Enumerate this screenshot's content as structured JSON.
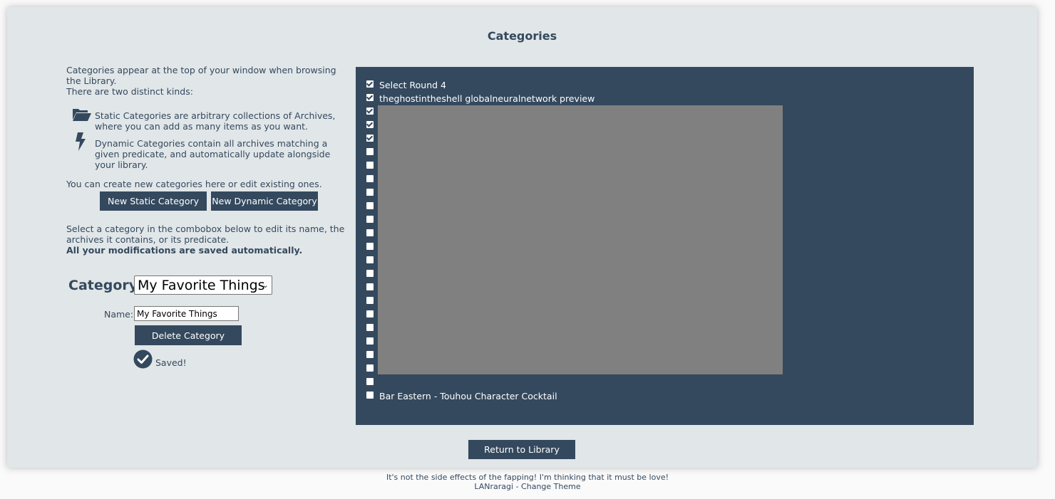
{
  "page": {
    "title": "Categories"
  },
  "intro": {
    "line1": "Categories appear at the top of your window when browsing the Library.",
    "line2": "There are two distinct kinds:",
    "static_desc": "Static Categories are arbitrary collections of Archives, where you can add as many items as you want.",
    "dynamic_desc": "Dynamic Categories contain all archives matching a given predicate, and automatically update alongside your library.",
    "create_note": "You can create new categories here or edit existing ones."
  },
  "buttons": {
    "new_static": "New Static Category",
    "new_dynamic": "New Dynamic Category",
    "delete": "Delete Category",
    "return": "Return to Library"
  },
  "edit_note": {
    "line1": "Select a category in the combobox below to edit its name, the archives it contains, or its predicate.",
    "line2": "All your modifications are saved automatically."
  },
  "form": {
    "category_label": "Category:",
    "category_selected": "My Favorite Things",
    "name_label": "Name:",
    "name_value": "My Favorite Things",
    "saved_text": "Saved!"
  },
  "archives": [
    {
      "label": "Select Round 4",
      "checked": true
    },
    {
      "label": "theghostintheshell globalneuralnetwork preview",
      "checked": true
    },
    {
      "label": "",
      "checked": true
    },
    {
      "label": "",
      "checked": true
    },
    {
      "label": "",
      "checked": true
    },
    {
      "label": "",
      "checked": false
    },
    {
      "label": "",
      "checked": false
    },
    {
      "label": "",
      "checked": false
    },
    {
      "label": "",
      "checked": false
    },
    {
      "label": "",
      "checked": false
    },
    {
      "label": "",
      "checked": false
    },
    {
      "label": "",
      "checked": false
    },
    {
      "label": "",
      "checked": false
    },
    {
      "label": "",
      "checked": false
    },
    {
      "label": "",
      "checked": false
    },
    {
      "label": "",
      "checked": false
    },
    {
      "label": "",
      "checked": false
    },
    {
      "label": "",
      "checked": false
    },
    {
      "label": "",
      "checked": false
    },
    {
      "label": "",
      "checked": false
    },
    {
      "label": "",
      "checked": false
    },
    {
      "label": "",
      "checked": false
    },
    {
      "label": "",
      "checked": false
    },
    {
      "label": "Bar Eastern - Touhou Character Cocktail",
      "checked": false
    }
  ],
  "footer": {
    "quote": "It's not the side effects of the fapping! I'm thinking that it must be love!",
    "app": "LANraragi",
    "separator": " - ",
    "theme_link": "Change Theme"
  },
  "icons": {
    "static": "folder-open-icon",
    "dynamic": "bolt-icon",
    "saved": "check-circle-icon"
  },
  "colors": {
    "accent": "#34495e",
    "panel": "#e1e6e8",
    "preview": "#808080"
  }
}
